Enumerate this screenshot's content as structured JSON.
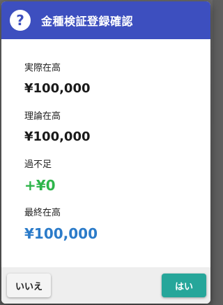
{
  "dialog": {
    "title": "金種検証登録確認",
    "icon": "question-icon",
    "header_color": "#3d4fbf"
  },
  "items": [
    {
      "label": "実際在高",
      "value": "¥100,000"
    },
    {
      "label": "理論在高",
      "value": "¥100,000"
    },
    {
      "label": "過不足",
      "value": "+¥0",
      "color": "#2eb54a"
    },
    {
      "label": "最終在高",
      "value": "¥100,000",
      "color": "#2b7bc9"
    }
  ],
  "footer": {
    "no_label": "いいえ",
    "yes_label": "はい",
    "yes_color": "#26a69a"
  }
}
